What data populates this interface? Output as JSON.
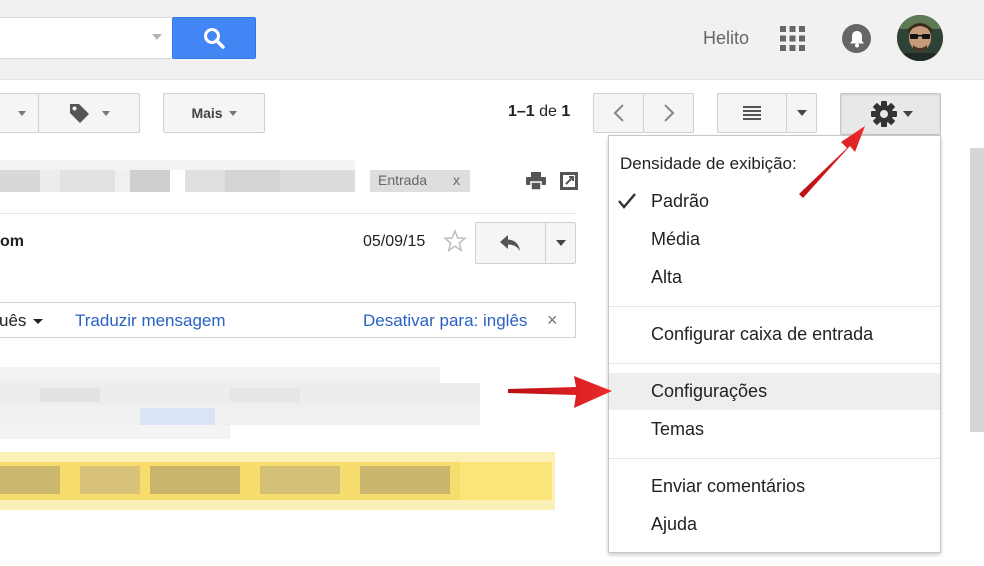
{
  "header": {
    "user_name": "Helito"
  },
  "toolbar": {
    "more_label": "Mais",
    "pager": {
      "range": "1–1",
      "of_label": "de",
      "total": "1"
    }
  },
  "message": {
    "label_chip": "Entrada",
    "label_remove": "x",
    "sender_fragment": "om",
    "date": "05/09/15"
  },
  "translate_bar": {
    "language_fragment": "uês",
    "translate_link": "Traduzir mensagem",
    "disable_link": "Desativar para: inglês",
    "close": "×"
  },
  "settings_menu": {
    "heading": "Densidade de exibição:",
    "density": [
      {
        "label": "Padrão",
        "checked": true
      },
      {
        "label": "Média",
        "checked": false
      },
      {
        "label": "Alta",
        "checked": false
      }
    ],
    "configure_inbox": "Configurar caixa de entrada",
    "settings": "Configurações",
    "themes": "Temas",
    "feedback": "Enviar comentários",
    "help": "Ajuda"
  },
  "colors": {
    "search_button": "#4285f4",
    "link": "#2962c3",
    "annotation_arrow": "#e0151b"
  },
  "icons": [
    "search-icon",
    "apps-grid-icon",
    "bell-icon",
    "label-icon",
    "chevron-left-icon",
    "chevron-right-icon",
    "list-view-icon",
    "gear-icon",
    "print-icon",
    "new-window-icon",
    "star-icon",
    "reply-icon",
    "check-icon"
  ]
}
